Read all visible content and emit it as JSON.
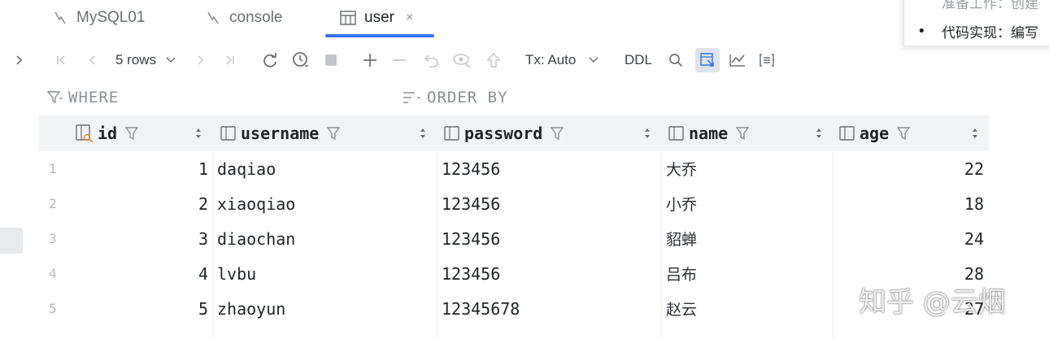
{
  "tabs": [
    {
      "label": "MySQL01",
      "icon": "datasource-icon",
      "active": false
    },
    {
      "label": "console",
      "icon": "console-icon",
      "active": false
    },
    {
      "label": "user",
      "icon": "table-icon",
      "active": true,
      "close": "×"
    }
  ],
  "popup": {
    "line1": "准备工作：创建",
    "bullet": "•",
    "line2": "代码实现：编写"
  },
  "toolbar": {
    "rows_label": "5 rows",
    "tx_label": "Tx: Auto",
    "ddl_label": "DDL"
  },
  "filters": {
    "where": "WHERE",
    "order_by": "ORDER BY"
  },
  "grid": {
    "columns": [
      "id",
      "username",
      "password",
      "name",
      "age"
    ],
    "rows": [
      {
        "n": "1",
        "id": "1",
        "username": "daqiao",
        "password": "123456",
        "name": "大乔",
        "age": "22"
      },
      {
        "n": "2",
        "id": "2",
        "username": "xiaoqiao",
        "password": "123456",
        "name": "小乔",
        "age": "18"
      },
      {
        "n": "3",
        "id": "3",
        "username": "diaochan",
        "password": "123456",
        "name": "貂蝉",
        "age": "24"
      },
      {
        "n": "4",
        "id": "4",
        "username": "lvbu",
        "password": "123456",
        "name": "吕布",
        "age": "28"
      },
      {
        "n": "5",
        "id": "5",
        "username": "zhaoyun",
        "password": "12345678",
        "name": "赵云",
        "age": "27"
      }
    ]
  },
  "watermark": "知乎 @云烟",
  "colors": {
    "accent": "#3574f0",
    "header_bg": "#f2f3f5",
    "muted": "#8a8f96"
  }
}
